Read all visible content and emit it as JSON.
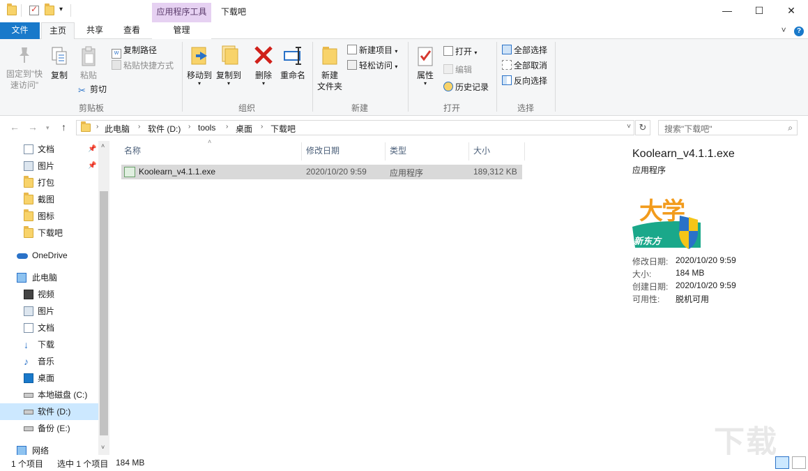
{
  "window": {
    "title": "下载吧",
    "context_tab_group": "应用程序工具",
    "minimize": "—",
    "maximize": "☐",
    "close": "✕"
  },
  "ribbon_tabs": {
    "file": "文件",
    "home": "主页",
    "share": "共享",
    "view": "查看",
    "manage": "管理",
    "collapse": "˅"
  },
  "ribbon": {
    "clipboard": {
      "label": "剪贴板",
      "pin_line1": "固定到\"快",
      "pin_line2": "速访问\"",
      "copy": "复制",
      "paste": "粘贴",
      "copy_path": "复制路径",
      "paste_shortcut": "粘贴快捷方式",
      "cut": "剪切"
    },
    "organize": {
      "label": "组织",
      "move_to": "移动到",
      "copy_to": "复制到",
      "delete": "删除",
      "rename": "重命名"
    },
    "new": {
      "label": "新建",
      "new_folder_line1": "新建",
      "new_folder_line2": "文件夹",
      "new_item": "新建项目",
      "easy_access": "轻松访问"
    },
    "open": {
      "label": "打开",
      "properties": "属性",
      "open": "打开",
      "edit": "编辑",
      "history": "历史记录"
    },
    "select": {
      "label": "选择",
      "select_all": "全部选择",
      "select_none": "全部取消",
      "invert": "反向选择"
    }
  },
  "address": {
    "crumbs": [
      "此电脑",
      "软件 (D:)",
      "tools",
      "桌面",
      "下载吧"
    ],
    "search_placeholder": "搜索\"下载吧\""
  },
  "nav": {
    "quick_access": [
      {
        "label": "文档",
        "icon": "document-icon",
        "pinned": true
      },
      {
        "label": "图片",
        "icon": "pictures-icon",
        "pinned": true
      },
      {
        "label": "打包",
        "icon": "folder-icon",
        "pinned": false
      },
      {
        "label": "截图",
        "icon": "folder-icon",
        "pinned": false
      },
      {
        "label": "图标",
        "icon": "folder-icon",
        "pinned": false
      },
      {
        "label": "下载吧",
        "icon": "folder-icon",
        "pinned": false
      }
    ],
    "onedrive": "OneDrive",
    "this_pc": "此电脑",
    "pc_items": [
      {
        "label": "视频",
        "icon": "video-icon"
      },
      {
        "label": "图片",
        "icon": "pictures-icon"
      },
      {
        "label": "文档",
        "icon": "document-icon"
      },
      {
        "label": "下载",
        "icon": "download-icon"
      },
      {
        "label": "音乐",
        "icon": "music-icon"
      },
      {
        "label": "桌面",
        "icon": "desktop-icon"
      },
      {
        "label": "本地磁盘 (C:)",
        "icon": "drive-c-icon"
      },
      {
        "label": "软件 (D:)",
        "icon": "drive-icon",
        "selected": true
      },
      {
        "label": "备份 (E:)",
        "icon": "drive-icon"
      }
    ],
    "network": "网络"
  },
  "file_list": {
    "columns": [
      "名称",
      "修改日期",
      "类型",
      "大小"
    ],
    "rows": [
      {
        "name": "Koolearn_v4.1.1.exe",
        "modified": "2020/10/20 9:59",
        "type": "应用程序",
        "size": "189,312 KB"
      }
    ]
  },
  "preview": {
    "title": "Koolearn_v4.1.1.exe",
    "subtitle": "应用程序",
    "logo_text": "大学",
    "logo_sub": "新东方",
    "colors": {
      "logo_orange": "#f29b1c",
      "logo_green": "#1aa88a",
      "shield_blue": "#2a72c8",
      "shield_yellow": "#f5c518"
    },
    "props": [
      {
        "label": "修改日期:",
        "value": "2020/10/20 9:59"
      },
      {
        "label": "大小:",
        "value": "184 MB"
      },
      {
        "label": "创建日期:",
        "value": "2020/10/20 9:59"
      },
      {
        "label": "可用性:",
        "value": "脱机可用"
      }
    ]
  },
  "status": {
    "count": "1 个项目",
    "selected": "选中 1 个项目",
    "size": "184 MB"
  },
  "watermark": "下载吧"
}
